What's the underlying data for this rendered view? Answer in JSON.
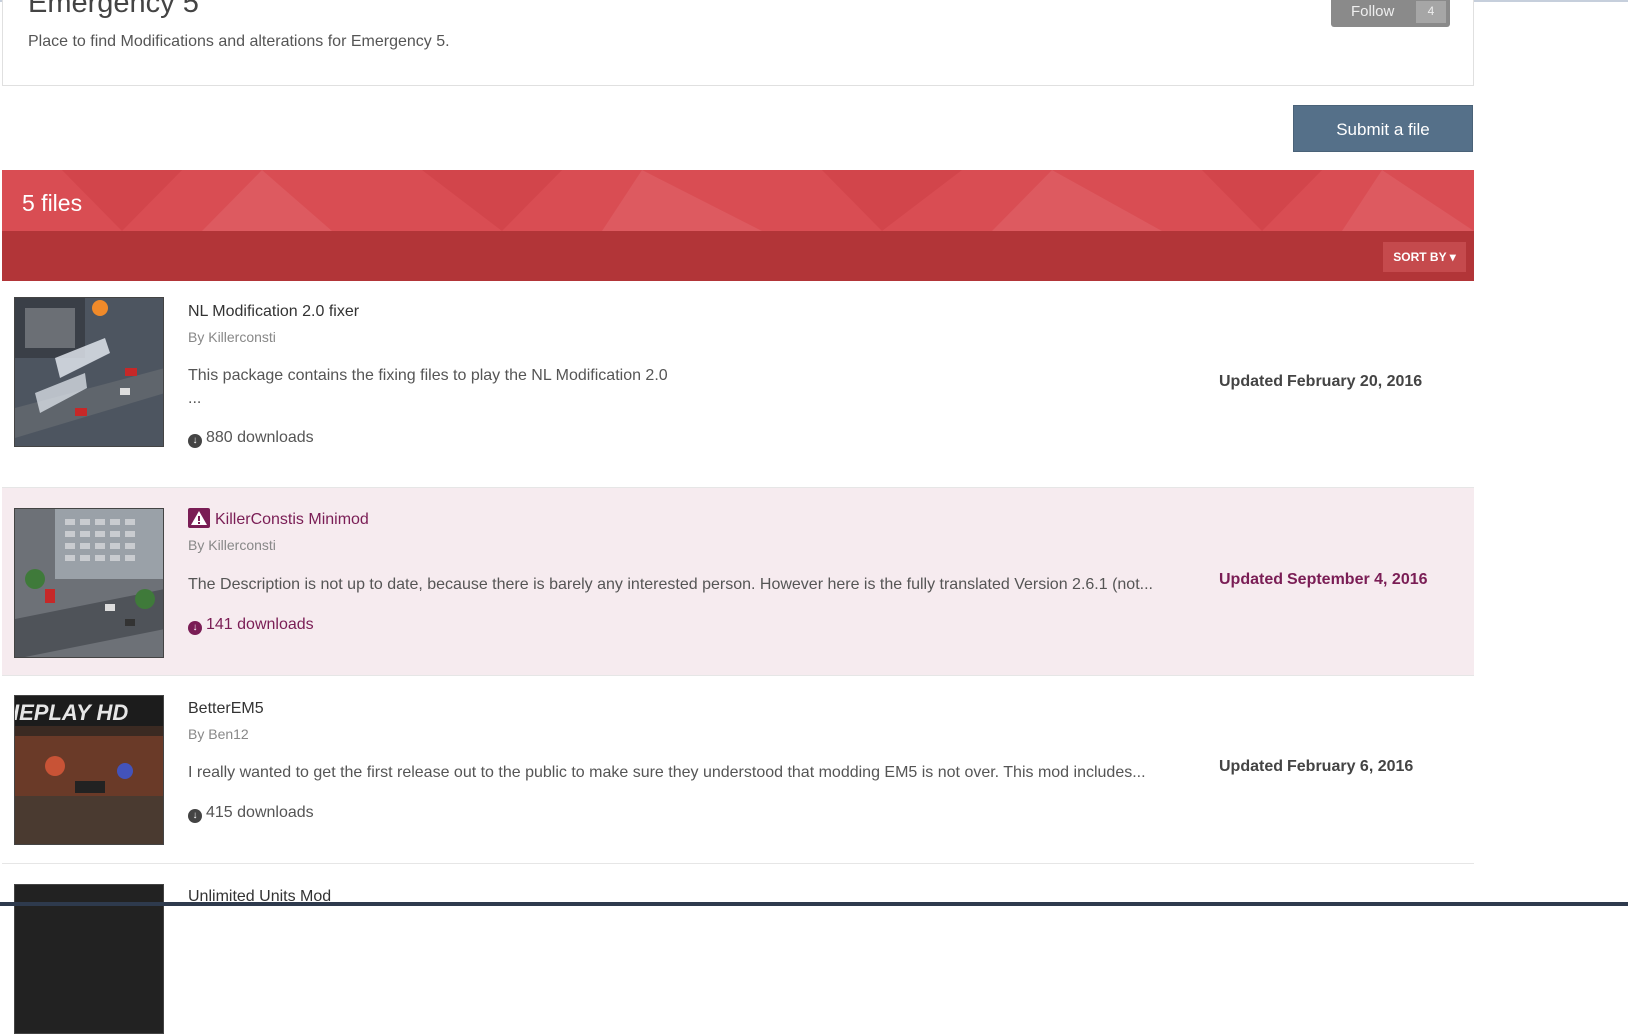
{
  "category": {
    "title": "Emergency 5",
    "description": "Place to find Modifications and alterations for Emergency 5.",
    "follow_label": "Follow",
    "follow_count": "4"
  },
  "submit_label": "Submit a file",
  "files_count": "5 files",
  "sort_label": "SORT BY ▾",
  "files": [
    {
      "title": "NL Modification 2.0 fixer",
      "author": "By Killerconsti",
      "description": "This package contains the fixing files to play the NL Modification 2.0",
      "description_more": "...",
      "downloads": "880 downloads",
      "updated_label": "Updated",
      "updated_date": "February 20, 2016"
    },
    {
      "title": "KillerConstis Minimod",
      "author": "By Killerconsti",
      "description": "The Description is not up to date, because there is barely any interested person. However here is the fully translated Version 2.6.1 (not...",
      "downloads": "141 downloads",
      "updated_label": "Updated",
      "updated_date": "September 4, 2016"
    },
    {
      "title": "BetterEM5",
      "author": "By Ben12",
      "description": "I really wanted to get the first release out to the public to make sure they understood that modding EM5 is not over. This mod includes...",
      "downloads": "415 downloads",
      "updated_label": "Updated",
      "updated_date": "February 6, 2016",
      "thumb_text": "IEPLAY HD"
    },
    {
      "title": "Unlimited Units Mod"
    }
  ],
  "icons": {
    "download": "download-circle-icon",
    "warning": "warning-triangle-icon"
  },
  "colors": {
    "banner_red": "#d94d53",
    "sort_bar_red": "#b23538",
    "featured_purple": "#7a1d55",
    "submit_blue": "#557089"
  }
}
